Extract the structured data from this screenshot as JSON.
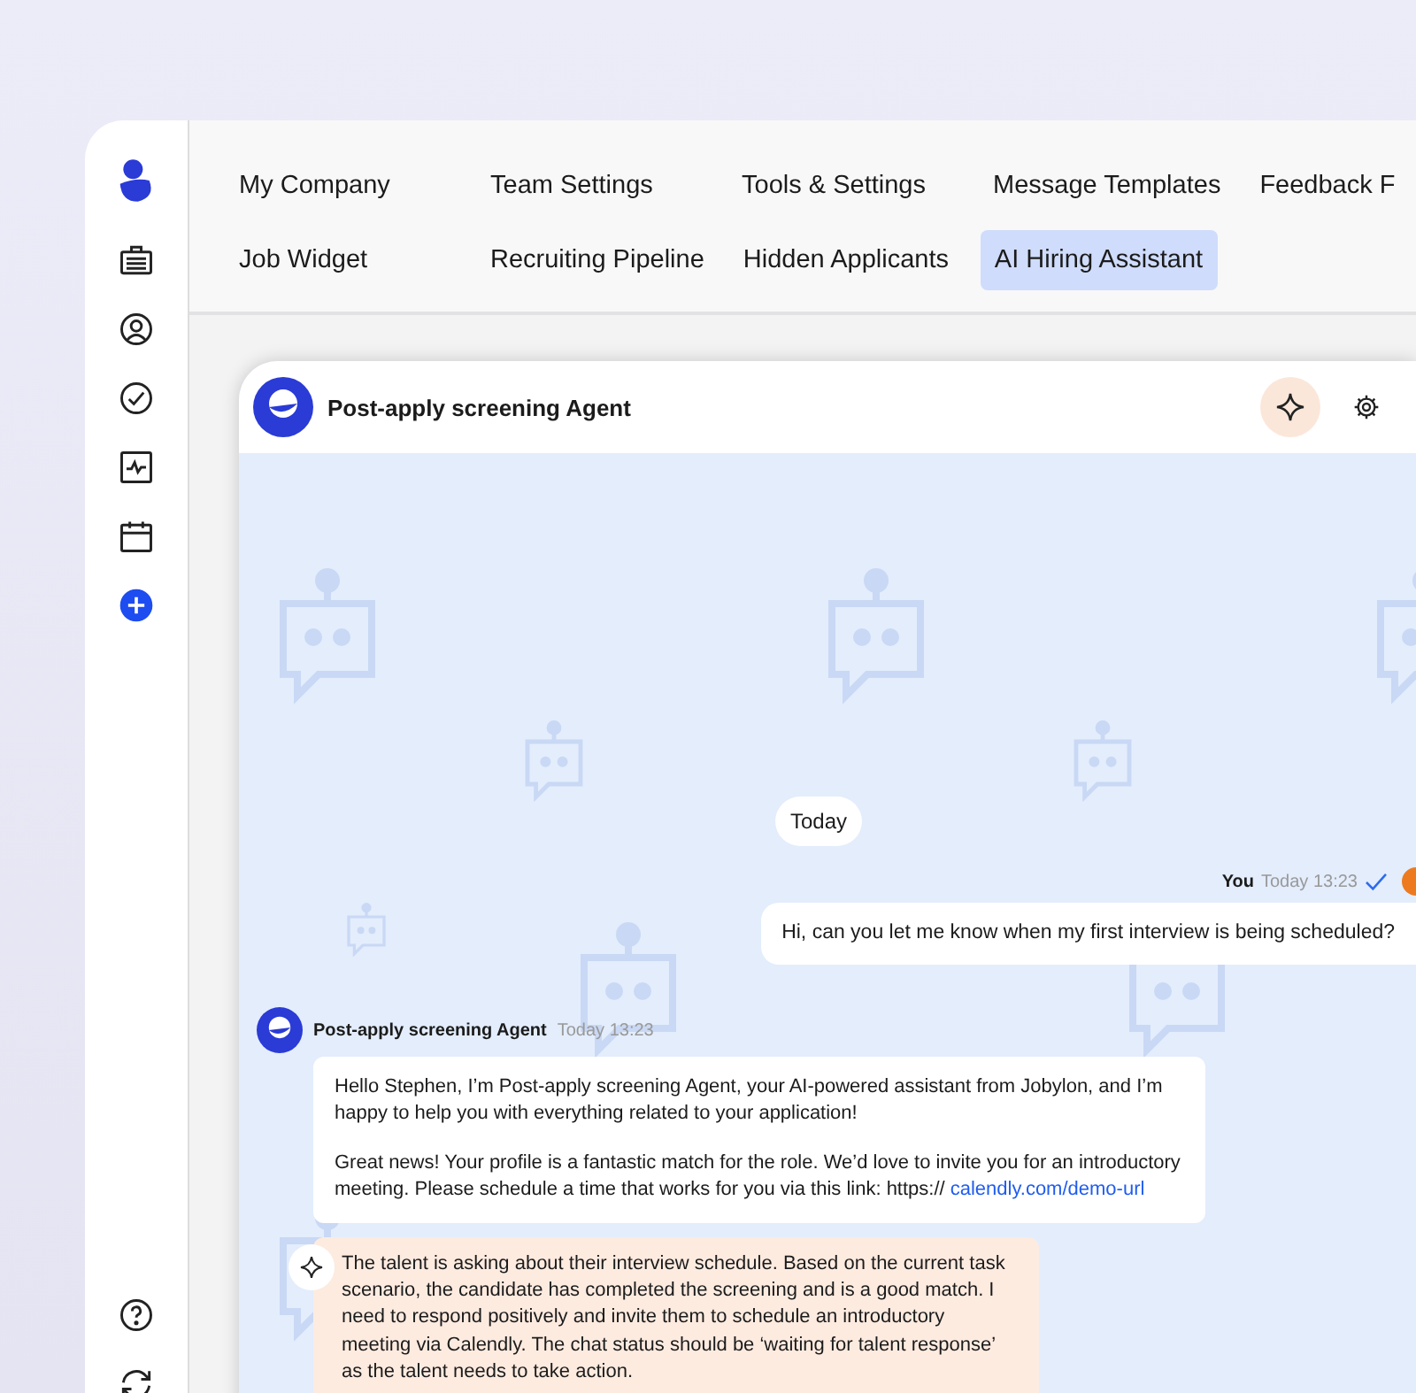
{
  "tab_rows": [
    [
      {
        "label": "My Company",
        "selected": false
      },
      {
        "label": "Team Settings",
        "selected": false
      },
      {
        "label": "Tools & Settings",
        "selected": false
      },
      {
        "label": "Message Templates",
        "selected": false
      },
      {
        "label": "Feedback F",
        "selected": false
      }
    ],
    [
      {
        "label": "Job Widget",
        "selected": false
      },
      {
        "label": "Recruiting Pipeline",
        "selected": false
      },
      {
        "label": "Hidden Applicants",
        "selected": false
      },
      {
        "label": "AI Hiring Assistant",
        "selected": true
      }
    ]
  ],
  "chat": {
    "title": "Post-apply screening Agent",
    "date_divider": "Today",
    "user_message": {
      "sender": "You",
      "time": "Today 13:23",
      "read": true,
      "text": "Hi, can you let me know when my first interview is being scheduled?"
    },
    "agent_message": {
      "sender": "Post-apply screening Agent",
      "time": "Today 13:23",
      "paragraphs": [
        "Hello Stephen, I’m Post-apply screening Agent, your AI-powered assistant from Jobylon, and I’m happy to help you with everything related to your application!",
        "Great news! Your profile is a fantastic match for the role. We’d love to invite you for an introductory meeting. Please schedule a time that works for you via this link: https://"
      ],
      "link": "calendly.com/demo-url"
    },
    "reasoning": "The talent is asking about their interview schedule. Based on the current task scenario, the candidate has completed the screening and is a good match. I need to respond positively and invite them to schedule an introductory meeting via Calendly. The chat status should be ‘waiting for talent response’ as the talent needs to take action."
  }
}
